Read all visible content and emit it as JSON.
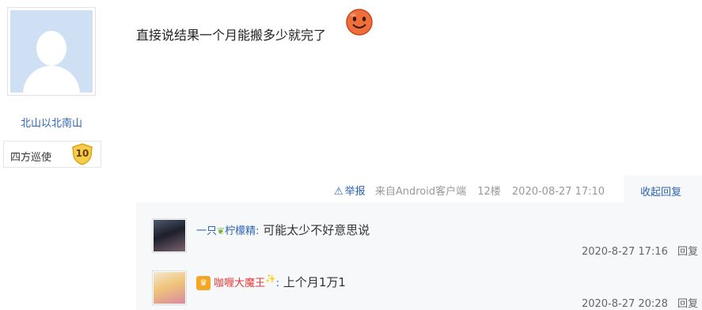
{
  "author": {
    "name": "北山以北南山",
    "badge_title": "四方巡使",
    "badge_level": "10",
    "avatar_icon": "default-avatar-icon"
  },
  "post": {
    "text": "直接说结果一个月能搬多少就完了",
    "emoji_icon": "grinning-face-emoji-icon"
  },
  "meta": {
    "report": "举报",
    "source": "来自Android客户端",
    "floor": "12楼",
    "time": "2020-08-27 17:10",
    "collapse": "收起回复"
  },
  "replies": [
    {
      "name_prefix": "一只",
      "name_suffix": "柠檬精",
      "colon": ":",
      "content": "可能太少不好意思说",
      "time": "2020-8-27 17:16",
      "reply_label": "回复"
    },
    {
      "name": "咖喱大魔王",
      "colon": ":",
      "content": "上个月1万1",
      "time": "2020-8-27 20:28",
      "reply_label": "回复"
    }
  ],
  "colors": {
    "link_blue": "#2d64b3",
    "reply_bg": "#f7f8fa",
    "name_red": "#e53935"
  }
}
